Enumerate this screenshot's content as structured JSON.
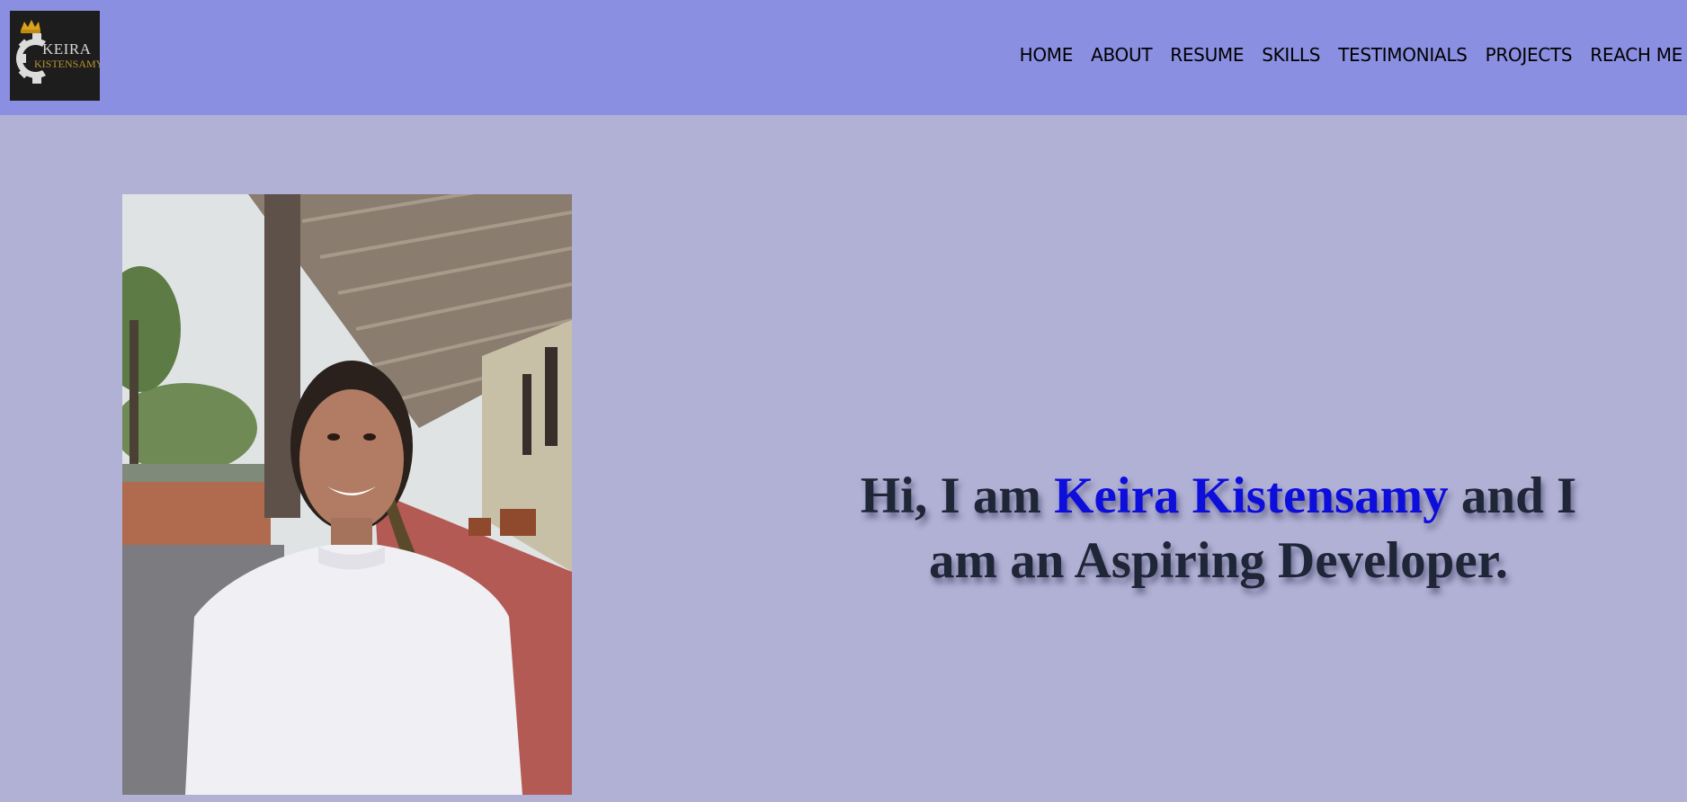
{
  "logo": {
    "line1": "KEIRA",
    "line2": "KISTENSAMY"
  },
  "nav": {
    "items": [
      {
        "label": "HOME"
      },
      {
        "label": "ABOUT"
      },
      {
        "label": "RESUME"
      },
      {
        "label": "SKILLS"
      },
      {
        "label": "TESTIMONIALS"
      },
      {
        "label": "PROJECTS"
      },
      {
        "label": "REACH ME"
      }
    ]
  },
  "hero": {
    "intro_prefix": "Hi, I am ",
    "name": "Keira Kistensamy",
    "intro_suffix": " and I am an Aspiring Developer."
  },
  "colors": {
    "navbar_bg": "#8a8fe1",
    "page_bg": "#b1b1d5",
    "name_accent": "#0d0ddc"
  }
}
